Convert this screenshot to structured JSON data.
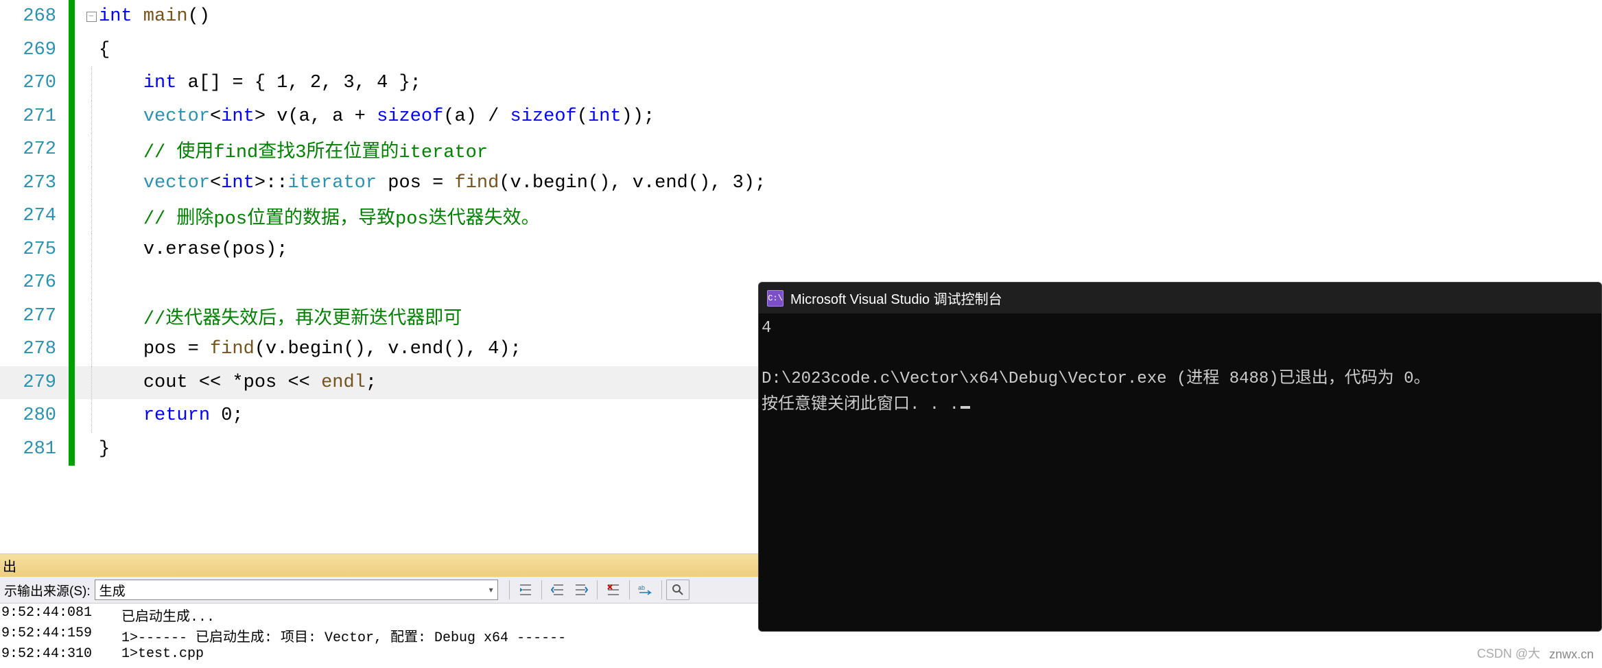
{
  "editor": {
    "lines": [
      {
        "num": "268",
        "collapse": true,
        "highlight": false
      },
      {
        "num": "269",
        "collapse": false,
        "highlight": false
      },
      {
        "num": "270",
        "collapse": false,
        "highlight": false
      },
      {
        "num": "271",
        "collapse": false,
        "highlight": false
      },
      {
        "num": "272",
        "collapse": false,
        "highlight": false
      },
      {
        "num": "273",
        "collapse": false,
        "highlight": false
      },
      {
        "num": "274",
        "collapse": false,
        "highlight": false
      },
      {
        "num": "275",
        "collapse": false,
        "highlight": false
      },
      {
        "num": "276",
        "collapse": false,
        "highlight": false
      },
      {
        "num": "277",
        "collapse": false,
        "highlight": false
      },
      {
        "num": "278",
        "collapse": false,
        "highlight": false
      },
      {
        "num": "279",
        "collapse": false,
        "highlight": true
      },
      {
        "num": "280",
        "collapse": false,
        "highlight": false
      },
      {
        "num": "281",
        "collapse": false,
        "highlight": false
      }
    ],
    "code": {
      "l268_kw": "int",
      "l268_fn": " main",
      "l268_rest": "()",
      "l269": "{",
      "l270_kw": "int",
      "l270_rest": " a[] = { 1, 2, 3, 4 };",
      "l271_1": "vector",
      "l271_2": "<",
      "l271_3": "int",
      "l271_4": "> v(a, a + ",
      "l271_5": "sizeof",
      "l271_6": "(a) / ",
      "l271_7": "sizeof",
      "l271_8": "(",
      "l271_9": "int",
      "l271_10": "));",
      "l272_cmt": "// 使用find查找3所在位置的iterator",
      "l273_1": "vector",
      "l273_2": "<",
      "l273_3": "int",
      "l273_4": ">::",
      "l273_5": "iterator",
      "l273_6": " pos = ",
      "l273_7": "find",
      "l273_8": "(v.begin(), v.end(), 3);",
      "l274_cmt": "// 删除pos位置的数据，导致pos迭代器失效。",
      "l275": "v.erase(pos);",
      "l276": "",
      "l277_cmt": "//迭代器失效后，再次更新迭代器即可",
      "l278_1": "pos = ",
      "l278_2": "find",
      "l278_3": "(v.begin(), v.end(), 4);",
      "l279_1": "cout << *pos << ",
      "l279_2": "endl",
      "l279_3": ";",
      "l280_kw": "return",
      "l280_rest": " 0;",
      "l281": "}"
    }
  },
  "output": {
    "panel_title": "出",
    "source_label": "示输出来源(S):",
    "source_value": "生成",
    "log": [
      {
        "ts": "9:52:44:081",
        "msg": "已启动生成..."
      },
      {
        "ts": "9:52:44:159",
        "msg": "1>------ 已启动生成: 项目: Vector, 配置: Debug x64 ------"
      },
      {
        "ts": "9:52:44:310",
        "msg": "1>test.cpp"
      }
    ]
  },
  "console": {
    "title": "Microsoft Visual Studio 调试控制台",
    "icon_text": "C:\\",
    "line1": "4",
    "line2": "D:\\2023code.c\\Vector\\x64\\Debug\\Vector.exe (进程 8488)已退出，代码为 0。",
    "line3": "按任意键关闭此窗口. . ."
  },
  "watermark": "znwx.cn",
  "watermark2": "CSDN @大"
}
